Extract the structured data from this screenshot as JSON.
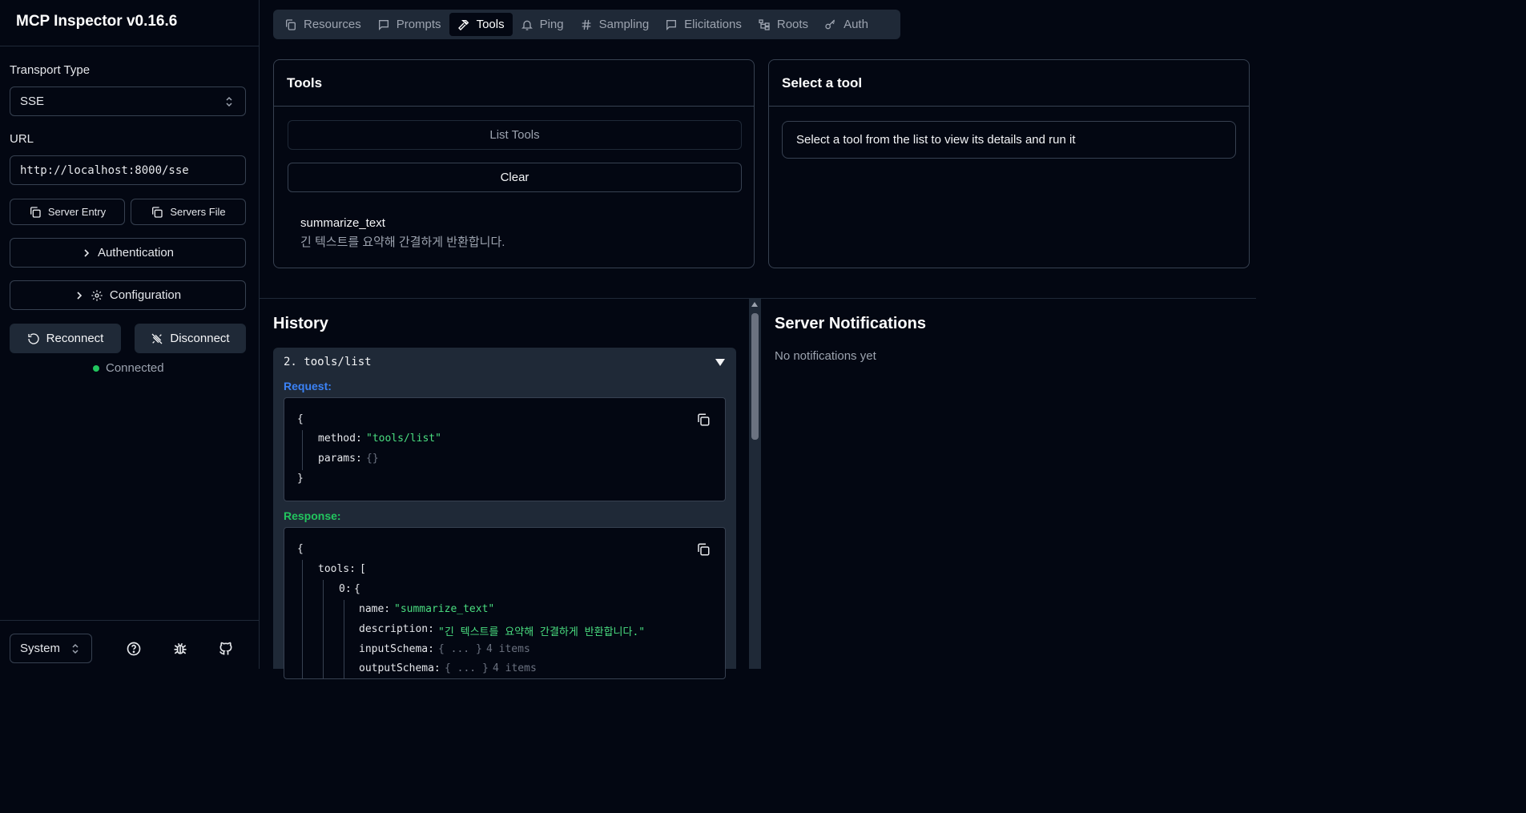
{
  "sidebar": {
    "title": "MCP Inspector v0.16.6",
    "transport_label": "Transport Type",
    "transport_value": "SSE",
    "url_label": "URL",
    "url_value": "http://localhost:8000/sse",
    "server_entry_label": "Server Entry",
    "servers_file_label": "Servers File",
    "authentication_label": "Authentication",
    "configuration_label": "Configuration",
    "reconnect_label": "Reconnect",
    "disconnect_label": "Disconnect",
    "status_text": "Connected",
    "status_color": "#22c55e",
    "theme_value": "System"
  },
  "tabs": [
    {
      "label": "Resources",
      "icon": "files-icon"
    },
    {
      "label": "Prompts",
      "icon": "message-icon"
    },
    {
      "label": "Tools",
      "icon": "hammer-icon",
      "active": true
    },
    {
      "label": "Ping",
      "icon": "bell-icon"
    },
    {
      "label": "Sampling",
      "icon": "hash-icon"
    },
    {
      "label": "Elicitations",
      "icon": "message-icon"
    },
    {
      "label": "Roots",
      "icon": "folder-tree-icon"
    },
    {
      "label": "Auth",
      "icon": "key-icon"
    }
  ],
  "tools_panel": {
    "title": "Tools",
    "list_tools_label": "List Tools",
    "clear_label": "Clear",
    "tool_name": "summarize_text",
    "tool_description": "긴 텍스트를 요약해 간결하게 반환합니다."
  },
  "select_panel": {
    "title": "Select a tool",
    "message": "Select a tool from the list to view its details and run it"
  },
  "history": {
    "title": "History",
    "entry_title": "2. tools/list",
    "request_label": "Request:",
    "response_label": "Response:",
    "request": {
      "open": "{",
      "method_key": "method:",
      "method_value": "\"tools/list\"",
      "params_key": "params:",
      "params_value": "{}",
      "close": "}"
    },
    "response": {
      "open": "{",
      "tools_key": "tools:",
      "tools_open": "[",
      "index_key": "0:",
      "index_open": "{",
      "name_key": "name:",
      "name_value": "\"summarize_text\"",
      "description_key": "description:",
      "description_value": "\"긴 텍스트를 요약해 간결하게 반환합니다.\"",
      "input_schema_key": "inputSchema:",
      "input_schema_value": "{ ... }",
      "input_schema_count": "4 items",
      "output_schema_key": "outputSchema:",
      "output_schema_value": "{ ... }",
      "output_schema_count": "4 items"
    }
  },
  "notifications": {
    "title": "Server Notifications",
    "empty": "No notifications yet"
  },
  "colors": {
    "background": "#030712",
    "border": "#374151",
    "request_label": "#3b82f6",
    "response_label": "#22c55e",
    "string_value": "#4ade80"
  }
}
